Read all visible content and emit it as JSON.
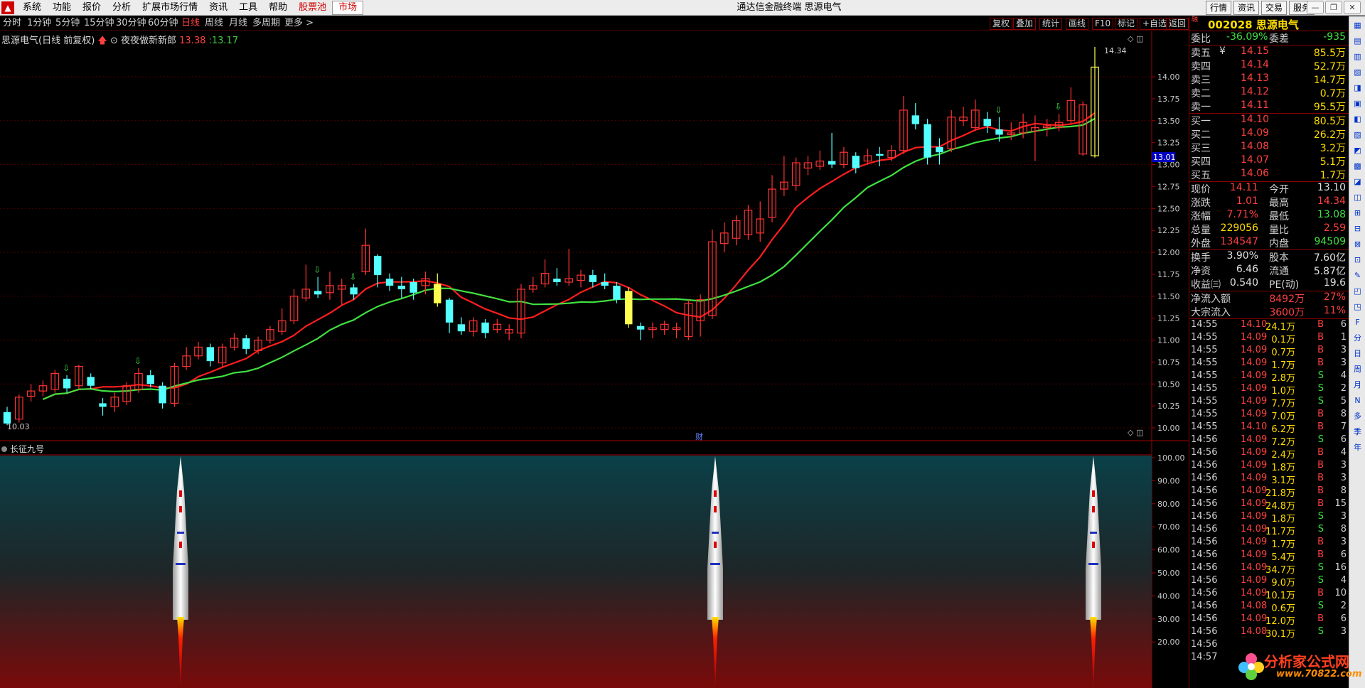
{
  "app": {
    "title": "通达信金融终端  思源电气",
    "menu": [
      "系统",
      "功能",
      "报价",
      "分析",
      "扩展市场行情",
      "资讯",
      "工具",
      "帮助"
    ],
    "menu_highlight": [
      "股票池",
      "市场"
    ],
    "right_buttons": [
      "行情",
      "资讯",
      "交易",
      "服务"
    ]
  },
  "periods": [
    "分时",
    "1分钟",
    "5分钟",
    "15分钟",
    "30分钟",
    "60分钟",
    "日线",
    "周线",
    "月线",
    "多周期",
    "更多 >"
  ],
  "active_period": "日线",
  "chart_tools": [
    "复权",
    "叠加",
    "统计",
    "画线",
    "F10",
    "标记",
    "+自选",
    "返回"
  ],
  "stock_header": {
    "name": "思源电气(日线 前复权)",
    "formula": "夜夜做新新郎",
    "v1": "13.38",
    "v2": ":13.17"
  },
  "indicator_name": "长征九号",
  "cai_label": "财",
  "quote": {
    "code": "002028",
    "name": "思源电气",
    "rz": "融",
    "weibi_label": "委比",
    "weibi": "-36.09%",
    "weicha_label": "委差",
    "weicha": "-935",
    "asks": [
      {
        "label": "卖五",
        "flag": "¥",
        "price": "14.15",
        "vol": "85.5万"
      },
      {
        "label": "卖四",
        "flag": "",
        "price": "14.14",
        "vol": "52.7万"
      },
      {
        "label": "卖三",
        "flag": "",
        "price": "14.13",
        "vol": "14.7万"
      },
      {
        "label": "卖二",
        "flag": "",
        "price": "14.12",
        "vol": "0.7万"
      },
      {
        "label": "卖一",
        "flag": "",
        "price": "14.11",
        "vol": "95.5万"
      }
    ],
    "bids": [
      {
        "label": "买一",
        "price": "14.10",
        "vol": "80.5万"
      },
      {
        "label": "买二",
        "price": "14.09",
        "vol": "26.2万"
      },
      {
        "label": "买三",
        "price": "14.08",
        "vol": "3.2万"
      },
      {
        "label": "买四",
        "price": "14.07",
        "vol": "5.1万"
      },
      {
        "label": "买五",
        "price": "14.06",
        "vol": "1.7万"
      }
    ],
    "stats": [
      {
        "l1": "现价",
        "v1": "14.11",
        "c1": "#ff4040",
        "l2": "今开",
        "v2": "13.10",
        "c2": "#e0e0e0"
      },
      {
        "l1": "涨跌",
        "v1": "1.01",
        "c1": "#ff4040",
        "l2": "最高",
        "v2": "14.34",
        "c2": "#ff4040"
      },
      {
        "l1": "涨幅",
        "v1": "7.71%",
        "c1": "#ff4040",
        "l2": "最低",
        "v2": "13.08",
        "c2": "#40e040"
      },
      {
        "l1": "总量",
        "v1": "229056",
        "c1": "#ffdc00",
        "l2": "量比",
        "v2": "2.59",
        "c2": "#ff4040"
      },
      {
        "l1": "外盘",
        "v1": "134547",
        "c1": "#ff4040",
        "l2": "内盘",
        "v2": "94509",
        "c2": "#40e040"
      }
    ],
    "stats2": [
      {
        "l1": "换手",
        "v1": "3.90%",
        "c1": "#e0e0e0",
        "l2": "股本",
        "v2": "7.60亿",
        "c2": "#e0e0e0"
      },
      {
        "l1": "净资",
        "v1": "6.46",
        "c1": "#e0e0e0",
        "l2": "流通",
        "v2": "5.87亿",
        "c2": "#e0e0e0"
      },
      {
        "l1": "收益㈢",
        "v1": "0.540",
        "c1": "#e0e0e0",
        "l2": "PE(动)",
        "v2": "19.6",
        "c2": "#e0e0e0"
      }
    ],
    "flows": [
      {
        "l": "净流入额",
        "v": "8492万",
        "p": "27%"
      },
      {
        "l": "大宗流入",
        "v": "3600万",
        "p": "11%"
      }
    ],
    "ticks": [
      [
        "14:55",
        "14.10",
        "24.1万",
        "B",
        "6"
      ],
      [
        "14:55",
        "14.09",
        "0.1万",
        "B",
        "1"
      ],
      [
        "14:55",
        "14.09",
        "0.7万",
        "B",
        "3"
      ],
      [
        "14:55",
        "14.09",
        "1.7万",
        "B",
        "3"
      ],
      [
        "14:55",
        "14.09",
        "2.8万",
        "S",
        "4"
      ],
      [
        "14:55",
        "14.09",
        "1.0万",
        "S",
        "2"
      ],
      [
        "14:55",
        "14.09",
        "7.7万",
        "S",
        "5"
      ],
      [
        "14:55",
        "14.09",
        "7.0万",
        "B",
        "8"
      ],
      [
        "14:55",
        "14.10",
        "6.2万",
        "B",
        "7"
      ],
      [
        "14:56",
        "14.09",
        "7.2万",
        "S",
        "6"
      ],
      [
        "14:56",
        "14.09",
        "2.4万",
        "B",
        "4"
      ],
      [
        "14:56",
        "14.09",
        "1.8万",
        "B",
        "3"
      ],
      [
        "14:56",
        "14.09",
        "3.1万",
        "B",
        "3"
      ],
      [
        "14:56",
        "14.09",
        "21.8万",
        "B",
        "8"
      ],
      [
        "14:56",
        "14.09",
        "24.8万",
        "B",
        "15"
      ],
      [
        "14:56",
        "14.09",
        "1.8万",
        "S",
        "3"
      ],
      [
        "14:56",
        "14.09",
        "11.7万",
        "S",
        "8"
      ],
      [
        "14:56",
        "14.09",
        "1.7万",
        "B",
        "3"
      ],
      [
        "14:56",
        "14.09",
        "5.4万",
        "B",
        "6"
      ],
      [
        "14:56",
        "14.09",
        "34.7万",
        "S",
        "16"
      ],
      [
        "14:56",
        "14.09",
        "9.0万",
        "S",
        "4"
      ],
      [
        "14:56",
        "14.09",
        "10.1万",
        "B",
        "10"
      ],
      [
        "14:56",
        "14.08",
        "0.6万",
        "S",
        "2"
      ],
      [
        "14:56",
        "14.09",
        "12.0万",
        "B",
        "6"
      ],
      [
        "14:56",
        "14.08",
        "30.1万",
        "S",
        "3"
      ],
      [
        "14:56",
        "",
        "",
        "",
        ""
      ],
      [
        "14:57",
        "",
        "",
        "",
        ""
      ]
    ]
  },
  "sidestrip": [
    "F",
    "分",
    "日",
    "周",
    "月",
    "N",
    "多",
    "季",
    "年"
  ],
  "watermark": {
    "text": "分析家公式网",
    "url": "www.70822.com"
  },
  "chart_data": {
    "type": "candlestick",
    "price_axis": [
      "14.00",
      "13.75",
      "13.50",
      "13.25",
      "13.00",
      "12.75",
      "12.50",
      "12.25",
      "12.00",
      "11.75",
      "11.50",
      "11.25",
      "11.00",
      "10.75",
      "10.50",
      "10.25",
      "10.00"
    ],
    "price_range": [
      10.0,
      14.0
    ],
    "current_price_marker": "13.01",
    "high_label": "14.34",
    "low_label": "10.03",
    "candles": [
      [
        10.18,
        10.05,
        10.24,
        10.03
      ],
      [
        10.1,
        10.35,
        10.38,
        10.06
      ],
      [
        10.36,
        10.42,
        10.5,
        10.3
      ],
      [
        10.42,
        10.48,
        10.54,
        10.36
      ],
      [
        10.44,
        10.62,
        10.66,
        10.4
      ],
      [
        10.56,
        10.45,
        10.6,
        10.4
      ],
      [
        10.48,
        10.7,
        10.72,
        10.44
      ],
      [
        10.58,
        10.48,
        10.62,
        10.44
      ],
      [
        10.28,
        10.24,
        10.34,
        10.14
      ],
      [
        10.24,
        10.35,
        10.4,
        10.18
      ],
      [
        10.3,
        10.48,
        10.52,
        10.26
      ],
      [
        10.44,
        10.62,
        10.68,
        10.4
      ],
      [
        10.6,
        10.5,
        10.66,
        10.46
      ],
      [
        10.48,
        10.28,
        10.52,
        10.22
      ],
      [
        10.28,
        10.7,
        10.74,
        10.24
      ],
      [
        10.7,
        10.82,
        10.92,
        10.66
      ],
      [
        10.82,
        10.92,
        10.98,
        10.78
      ],
      [
        10.92,
        10.76,
        10.96,
        10.7
      ],
      [
        10.74,
        10.92,
        10.96,
        10.7
      ],
      [
        10.92,
        11.02,
        11.08,
        10.88
      ],
      [
        11.02,
        10.9,
        11.06,
        10.84
      ],
      [
        10.88,
        11.0,
        11.04,
        10.84
      ],
      [
        11.0,
        11.12,
        11.16,
        10.96
      ],
      [
        11.1,
        11.22,
        11.36,
        11.06
      ],
      [
        11.22,
        11.5,
        11.58,
        11.18
      ],
      [
        11.48,
        11.58,
        11.86,
        11.44
      ],
      [
        11.56,
        11.52,
        11.72,
        11.48
      ],
      [
        11.54,
        11.62,
        11.78,
        11.46
      ],
      [
        11.58,
        11.62,
        11.7,
        11.4
      ],
      [
        11.6,
        11.52,
        11.64,
        11.46
      ],
      [
        11.78,
        12.08,
        12.27,
        11.74
      ],
      [
        11.96,
        11.74,
        11.98,
        11.6
      ],
      [
        11.7,
        11.62,
        11.76,
        11.56
      ],
      [
        11.62,
        11.58,
        11.72,
        11.48
      ],
      [
        11.66,
        11.54,
        11.7,
        11.46
      ],
      [
        11.62,
        11.7,
        11.78,
        11.52
      ],
      [
        11.64,
        11.42,
        11.76,
        11.38
      ],
      [
        11.46,
        11.2,
        11.48,
        11.08
      ],
      [
        11.18,
        11.1,
        11.26,
        11.06
      ],
      [
        11.1,
        11.22,
        11.26,
        11.04
      ],
      [
        11.2,
        11.08,
        11.24,
        11.02
      ],
      [
        11.12,
        11.18,
        11.24,
        11.08
      ],
      [
        11.08,
        11.12,
        11.18,
        11.0
      ],
      [
        11.08,
        11.58,
        11.64,
        11.02
      ],
      [
        11.58,
        11.62,
        11.72,
        11.54
      ],
      [
        11.64,
        11.76,
        11.92,
        11.6
      ],
      [
        11.7,
        11.66,
        11.82,
        11.62
      ],
      [
        11.66,
        11.7,
        12.04,
        11.62
      ],
      [
        11.68,
        11.74,
        11.8,
        11.6
      ],
      [
        11.74,
        11.66,
        11.8,
        11.6
      ],
      [
        11.66,
        11.62,
        11.76,
        11.58
      ],
      [
        11.62,
        11.46,
        11.66,
        11.42
      ],
      [
        11.56,
        11.18,
        11.6,
        11.14
      ],
      [
        11.16,
        11.12,
        11.2,
        11.0
      ],
      [
        11.12,
        11.14,
        11.2,
        11.02
      ],
      [
        11.12,
        11.18,
        11.22,
        11.06
      ],
      [
        11.12,
        11.14,
        11.2,
        11.02
      ],
      [
        11.04,
        11.42,
        11.46,
        11.0
      ],
      [
        11.22,
        11.46,
        11.52,
        11.04
      ],
      [
        11.28,
        12.12,
        12.26,
        11.24
      ],
      [
        12.1,
        12.22,
        12.34,
        12.0
      ],
      [
        12.16,
        12.36,
        12.42,
        12.08
      ],
      [
        12.2,
        12.48,
        12.54,
        12.14
      ],
      [
        12.22,
        12.38,
        12.58,
        12.12
      ],
      [
        12.4,
        12.72,
        12.88,
        12.34
      ],
      [
        12.72,
        12.8,
        13.1,
        12.64
      ],
      [
        12.76,
        13.02,
        13.08,
        12.7
      ],
      [
        12.96,
        13.02,
        13.1,
        12.88
      ],
      [
        12.98,
        13.04,
        13.16,
        12.94
      ],
      [
        13.04,
        13.0,
        13.36,
        12.96
      ],
      [
        13.0,
        13.14,
        13.2,
        12.96
      ],
      [
        13.1,
        12.96,
        13.14,
        12.9
      ],
      [
        13.04,
        13.1,
        13.18,
        13.0
      ],
      [
        13.12,
        13.1,
        13.2,
        12.98
      ],
      [
        13.08,
        13.16,
        13.22,
        13.04
      ],
      [
        13.16,
        13.62,
        13.78,
        13.12
      ],
      [
        13.56,
        13.46,
        13.7,
        13.4
      ],
      [
        13.46,
        13.08,
        13.52,
        13.0
      ],
      [
        13.2,
        13.14,
        13.3,
        13.0
      ],
      [
        13.18,
        13.54,
        13.62,
        13.14
      ],
      [
        13.5,
        13.54,
        13.66,
        13.44
      ],
      [
        13.42,
        13.62,
        13.74,
        13.38
      ],
      [
        13.52,
        13.44,
        13.6,
        13.36
      ],
      [
        13.4,
        13.34,
        13.54,
        13.26
      ],
      [
        13.34,
        13.36,
        13.48,
        13.28
      ],
      [
        13.36,
        13.48,
        13.58,
        13.3
      ],
      [
        13.38,
        13.42,
        13.56,
        13.04
      ],
      [
        13.42,
        13.44,
        13.52,
        13.32
      ],
      [
        13.42,
        13.48,
        13.58,
        13.38
      ],
      [
        13.5,
        13.73,
        13.88,
        13.46
      ],
      [
        13.12,
        13.68,
        13.72,
        13.1
      ],
      [
        13.1,
        14.11,
        14.34,
        13.08
      ]
    ],
    "indicator_axis": [
      "100.00",
      "90.00",
      "80.00",
      "70.00",
      "60.00",
      "50.00",
      "40.00",
      "30.00",
      "20.00"
    ],
    "signal_candles": [
      12,
      48,
      89
    ]
  }
}
